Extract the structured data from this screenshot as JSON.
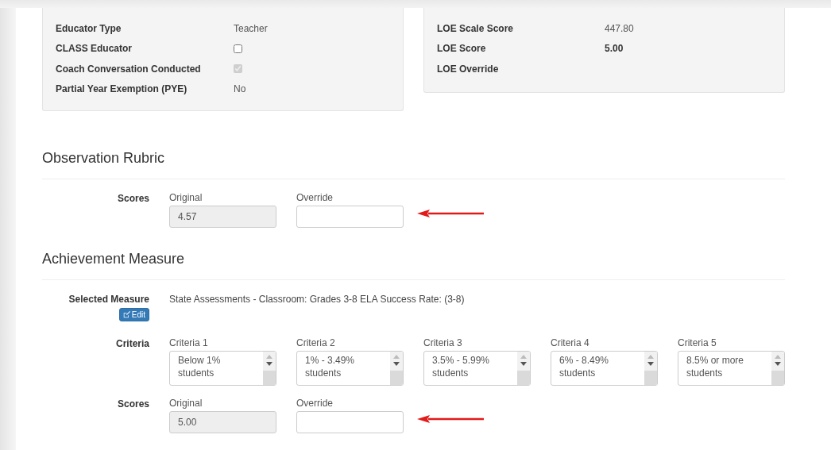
{
  "info_panels": [
    {
      "rows": [
        {
          "kind": "text",
          "label": "Educator Type",
          "value": "Teacher"
        },
        {
          "kind": "checkbox",
          "label": "CLASS Educator",
          "checked": false,
          "disabled": false
        },
        {
          "kind": "checkbox",
          "label": "Coach Conversation Conducted",
          "checked": true,
          "disabled": true
        },
        {
          "kind": "text",
          "label": "Partial Year Exemption (PYE)",
          "value": "No"
        }
      ]
    },
    {
      "rows": [
        {
          "kind": "text",
          "label": "LOE Scale Score",
          "value": "447.80"
        },
        {
          "kind": "bold",
          "label": "LOE Score",
          "value": "5.00"
        },
        {
          "kind": "text",
          "label": "LOE Override"
        }
      ]
    }
  ],
  "sections": [
    {
      "title": "Observation Rubric",
      "fields": [
        {
          "kind": "scores",
          "label": "Scores",
          "original_label": "Original",
          "original_value": "4.57",
          "override_label": "Override",
          "arrow": true
        }
      ]
    },
    {
      "title": "Achievement Measure",
      "fields": [
        {
          "kind": "measure",
          "label": "Selected Measure",
          "value": "State Assessments - Classroom: Grades 3-8 ELA Success Rate: (3-8)",
          "button": "Edit"
        },
        {
          "kind": "criteria",
          "label": "Criteria",
          "items": [
            {
              "label": "Criteria 1",
              "value": "Below 1%\nstudents"
            },
            {
              "label": "Criteria 2",
              "value": "1% - 3.49%\nstudents"
            },
            {
              "label": "Criteria 3",
              "value": "3.5% - 5.99%\nstudents"
            },
            {
              "label": "Criteria 4",
              "value": "6% - 8.49%\nstudents"
            },
            {
              "label": "Criteria 5",
              "value": "8.5% or more\nstudents"
            }
          ]
        },
        {
          "kind": "scores",
          "label": "Scores",
          "original_label": "Original",
          "original_value": "5.00",
          "override_label": "Override",
          "arrow": true
        }
      ]
    }
  ]
}
